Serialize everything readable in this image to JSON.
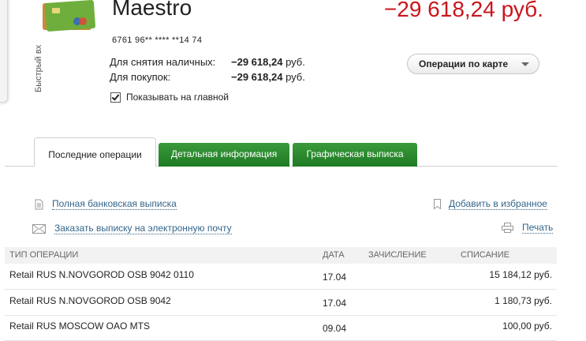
{
  "side_tab": {
    "label": "Быстрый вх"
  },
  "card": {
    "name": "Maestro",
    "balance": "−29 618,24 руб.",
    "number": "6761 96** **** **14 74",
    "cash_label": "Для снятия наличных:",
    "cash_amount": "−29 618,24",
    "purchase_label": "Для покупок:",
    "purchase_amount": "−29 618,24",
    "currency": "руб.",
    "ops_button": "Операции по карте",
    "show_main": "Показывать на главной"
  },
  "tabs": [
    "Последние операции",
    "Детальная информация",
    "Графическая выписка"
  ],
  "links": {
    "full_statement": "Полная банковская выписка",
    "email_statement": "Заказать выписку на электронную почту",
    "add_favorite": "Добавить в избранное",
    "print": "Печать"
  },
  "table": {
    "headers": [
      "ТИП ОПЕРАЦИИ",
      "ДАТА",
      "ЗАЧИСЛЕНИЕ",
      "СПИСАНИЕ"
    ],
    "rows": [
      {
        "type": "Retail RUS N.NOVGOROD OSB 9042 0110",
        "date": "17.04",
        "credit": "",
        "debit": "15 184,12 руб."
      },
      {
        "type": "Retail RUS N.NOVGOROD OSB 9042",
        "date": "17.04",
        "credit": "",
        "debit": "1 180,73 руб."
      },
      {
        "type": "Retail RUS MOSCOW OAO MTS",
        "date": "09.04",
        "credit": "",
        "debit": "100,00 руб."
      }
    ]
  },
  "colors": {
    "accent_red": "#c8161c",
    "tab_green": "#2a8a2e",
    "link_blue": "#34658a"
  }
}
